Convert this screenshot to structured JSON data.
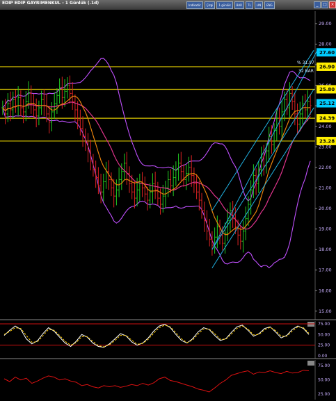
{
  "window": {
    "title": "EDIP EDIP GAYRIMENKUL - 1 Günlük (.1d)",
    "toolbar": [
      "Indikatör",
      "Çizgi",
      "1 günlük",
      "BAR",
      "TL",
      "LIN",
      "ENG"
    ]
  },
  "chart_data": [
    {
      "type": "candlestick",
      "ylim": [
        14.75,
        29.2
      ],
      "y_ticks": [
        "29.00",
        "28.00",
        "27.00",
        "26.00",
        "25.00",
        "24.00",
        "23.00",
        "22.00",
        "21.00",
        "20.00",
        "19.00",
        "18.00",
        "17.00",
        "16.00",
        "15.00"
      ],
      "price_boxes": [
        {
          "label": "27.60",
          "value": 27.6,
          "bg": "#00ccff"
        },
        {
          "label": "26.90",
          "value": 26.9,
          "bg": "#ffee00"
        },
        {
          "label": "25.80",
          "value": 25.8,
          "bg": "#ffee00"
        },
        {
          "label": "25.12",
          "value": 25.12,
          "bg": "#00ccff"
        },
        {
          "label": "24.39",
          "value": 24.39,
          "bg": "#ffee00"
        },
        {
          "label": "23.28",
          "value": 23.28,
          "bg": "#ffee00"
        }
      ],
      "horizontal_lines": [
        26.9,
        25.8,
        24.39,
        23.28
      ],
      "annotations": {
        "pct": "% 31.97",
        "bars": "32 BAR"
      },
      "closes": [
        24.9,
        24.6,
        25.1,
        24.8,
        25.3,
        25.0,
        25.4,
        24.9,
        24.7,
        25.2,
        25.6,
        25.1,
        24.8,
        24.5,
        24.9,
        25.3,
        25.0,
        24.6,
        24.2,
        24.7,
        25.1,
        25.5,
        25.9,
        25.4,
        25.7,
        26.0,
        25.6,
        25.2,
        24.8,
        24.3,
        23.9,
        23.5,
        23.2,
        22.8,
        22.3,
        21.9,
        21.5,
        21.1,
        20.8,
        21.3,
        21.8,
        21.4,
        21.0,
        20.6,
        20.9,
        21.4,
        21.8,
        22.2,
        21.7,
        21.2,
        20.8,
        20.5,
        20.9,
        21.3,
        21.0,
        20.7,
        20.4,
        20.8,
        21.2,
        20.9,
        20.5,
        20.2,
        20.6,
        21.0,
        21.4,
        21.1,
        21.5,
        21.9,
        22.2,
        21.8,
        21.4,
        21.7,
        22.0,
        21.6,
        21.2,
        20.8,
        20.4,
        19.9,
        19.4,
        18.9,
        18.5,
        18.2,
        18.6,
        19.1,
        18.7,
        18.3,
        18.8,
        19.4,
        19.9,
        19.5,
        19.1,
        18.7,
        18.4,
        18.9,
        19.5,
        20.2,
        20.9,
        21.6,
        21.2,
        21.9,
        22.5,
        22.1,
        22.8,
        23.5,
        23.1,
        23.8,
        24.4,
        24.0,
        24.7,
        25.3,
        24.9,
        25.6,
        25.2,
        24.6,
        24.1,
        24.6,
        25.1,
        24.8,
        25.2,
        25.0
      ],
      "overlays": [
        {
          "color": "#e0348c"
        },
        {
          "color": "#e8820c"
        },
        {
          "color": "#c050ff"
        }
      ],
      "channel_color": "#20b0e0"
    },
    {
      "type": "line",
      "ylim": [
        0,
        75
      ],
      "y_ticks": [
        "75.00",
        "50.00",
        "25.00",
        "0.00"
      ],
      "reference_lines": [
        75,
        25
      ],
      "series": [
        {
          "color": "#ffffff",
          "values": [
            48,
            60,
            70,
            62,
            40,
            28,
            35,
            52,
            66,
            58,
            44,
            30,
            22,
            34,
            50,
            44,
            30,
            22,
            20,
            28,
            40,
            52,
            47,
            33,
            25,
            30,
            42,
            58,
            70,
            74,
            66,
            50,
            36,
            30,
            40,
            56,
            66,
            62,
            48,
            36,
            40,
            55,
            68,
            72,
            60,
            46,
            52,
            64,
            68,
            56,
            42,
            48,
            62,
            70,
            64,
            50
          ]
        },
        {
          "color": "#ffcc00",
          "values": [
            50,
            57,
            66,
            64,
            48,
            32,
            33,
            47,
            62,
            60,
            48,
            34,
            25,
            31,
            45,
            45,
            34,
            24,
            21,
            26,
            36,
            48,
            48,
            37,
            27,
            29,
            39,
            53,
            66,
            72,
            68,
            54,
            40,
            31,
            37,
            51,
            63,
            63,
            52,
            39,
            39,
            51,
            64,
            70,
            63,
            49,
            50,
            61,
            67,
            59,
            46,
            46,
            58,
            68,
            66,
            53
          ]
        }
      ]
    },
    {
      "type": "line",
      "ylim": [
        18,
        80
      ],
      "y_ticks": [
        "75.00",
        "50.00",
        "25.00"
      ],
      "series": [
        {
          "color": "#dd1111",
          "values": [
            52,
            47,
            55,
            50,
            53,
            44,
            48,
            53,
            57,
            55,
            50,
            52,
            48,
            46,
            40,
            42,
            38,
            36,
            40,
            38,
            40,
            37,
            39,
            42,
            40,
            44,
            41,
            45,
            52,
            55,
            49,
            47,
            44,
            41,
            38,
            34,
            32,
            29,
            36,
            44,
            50,
            58,
            61,
            64,
            66,
            60,
            64,
            63,
            66,
            63,
            61,
            65,
            62,
            63,
            67,
            66
          ]
        }
      ]
    }
  ]
}
